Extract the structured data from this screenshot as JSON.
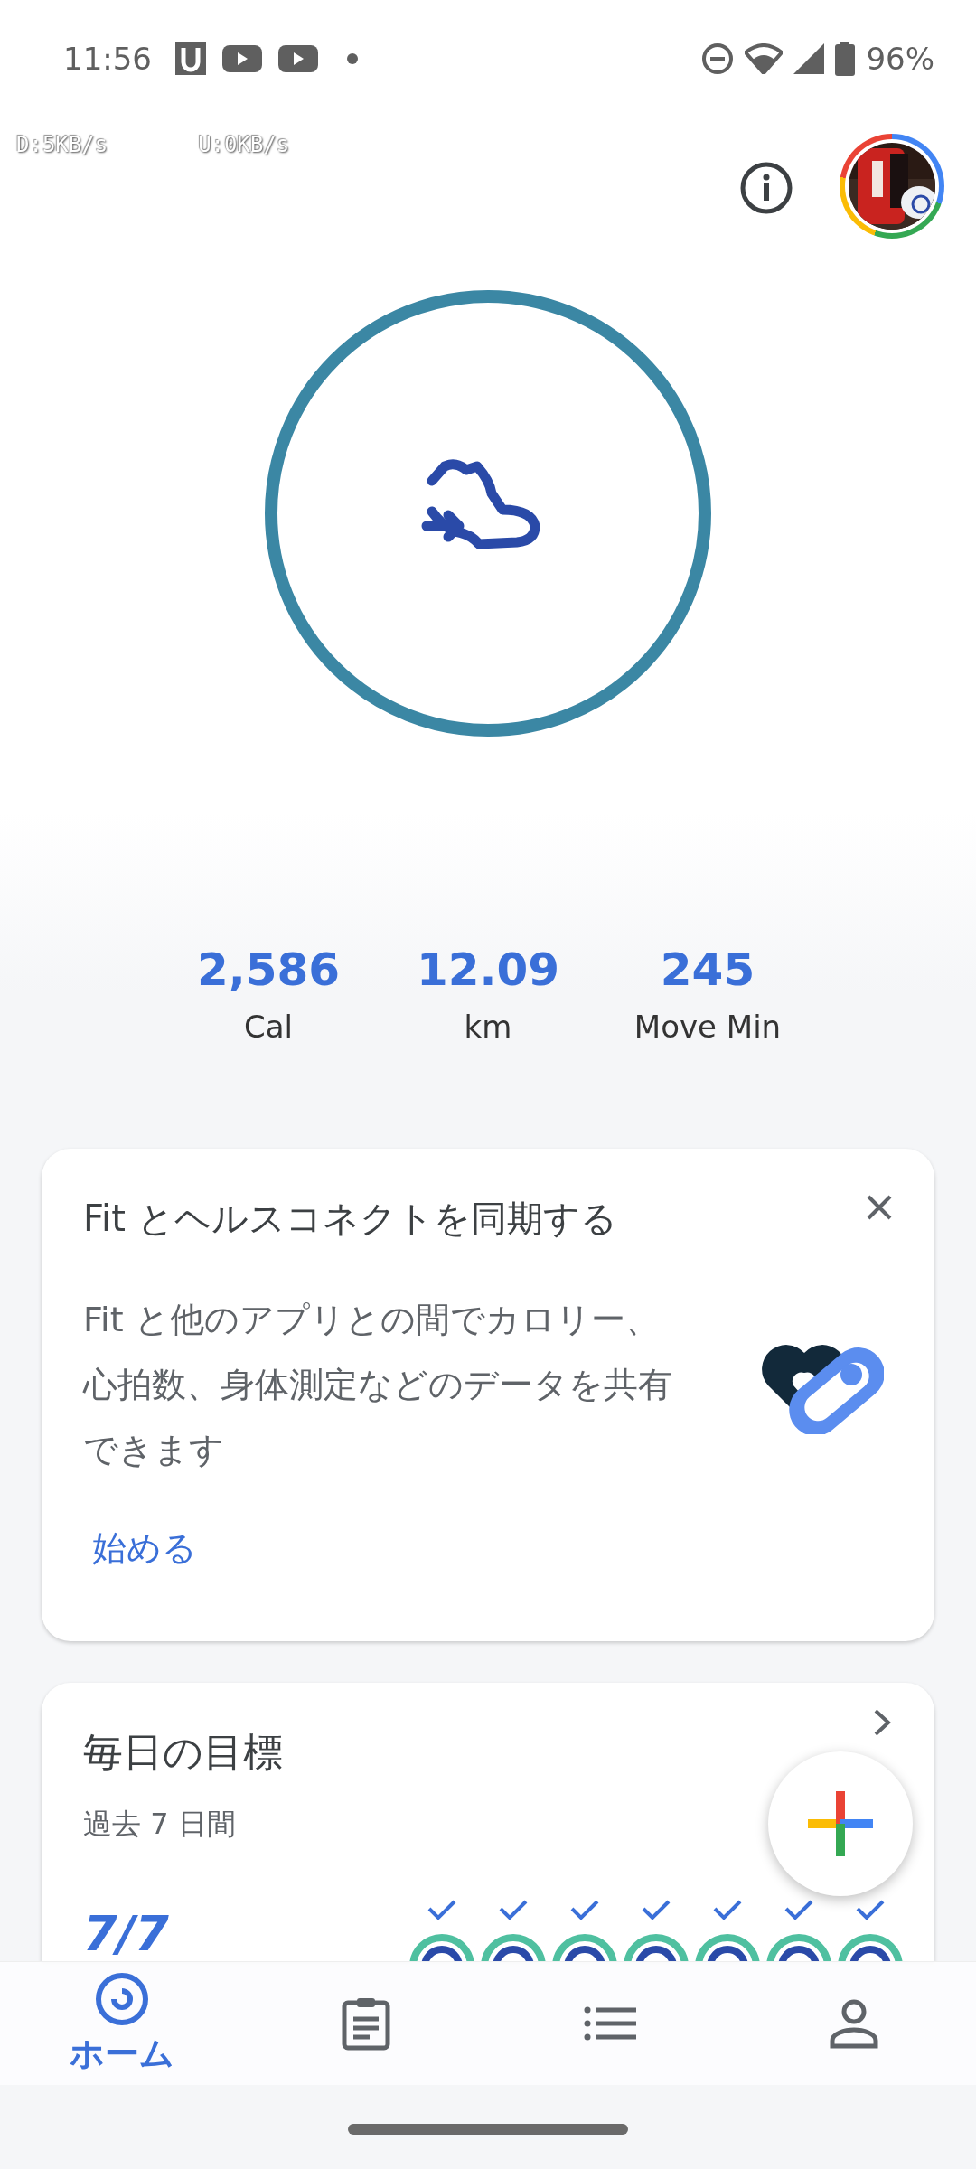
{
  "status_bar": {
    "time": "11:56",
    "battery": "96%"
  },
  "net_speed": {
    "download": "D:5KB/s",
    "upload": "U:0KB/s"
  },
  "stats": [
    {
      "value": "2,586",
      "label": "Cal"
    },
    {
      "value": "12.09",
      "label": "km"
    },
    {
      "value": "245",
      "label": "Move Min"
    }
  ],
  "sync_card": {
    "title": "Fit とヘルスコネクトを同期する",
    "body": "Fit と他のアプリとの間でカロリー、心拍数、身体測定などのデータを共有できます",
    "action": "始める"
  },
  "goals_card": {
    "title": "毎日の目標",
    "subtitle": "過去 7 日間",
    "score": "7/7",
    "days": [
      {
        "checked": true
      },
      {
        "checked": true
      },
      {
        "checked": true
      },
      {
        "checked": true
      },
      {
        "checked": true
      },
      {
        "checked": true
      },
      {
        "checked": true
      }
    ]
  },
  "nav": [
    {
      "kind": "home",
      "label": "ホーム",
      "selected": true
    },
    {
      "kind": "journal",
      "selected": false
    },
    {
      "kind": "browse",
      "selected": false
    },
    {
      "kind": "profile",
      "selected": false
    }
  ]
}
